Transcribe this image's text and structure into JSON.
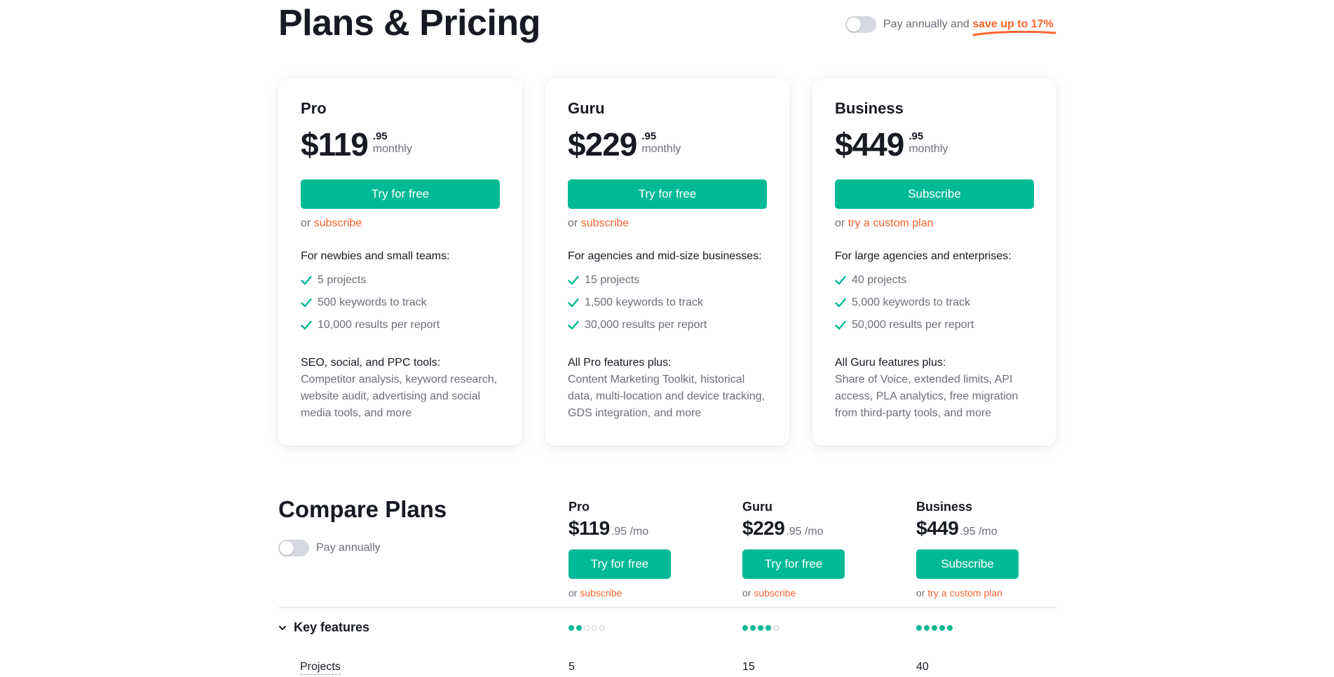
{
  "header": {
    "title": "Plans & Pricing",
    "billing_toggle": {
      "on": false,
      "label_prefix": "Pay annually and",
      "label_highlight": "save up to 17%"
    }
  },
  "plans": [
    {
      "name": "Pro",
      "price_main": "$119",
      "price_cents": ".95",
      "period": "monthly",
      "cta": "Try for free",
      "alt_prefix": "or",
      "alt_link": "subscribe",
      "audience": "For newbies and small teams:",
      "features": [
        "5 projects",
        "500 keywords to track",
        "10,000 results per report"
      ],
      "tools_heading": "SEO, social, and PPC tools:",
      "tools_desc": "Competitor analysis, keyword research, website audit, advertising and social media tools, and more"
    },
    {
      "name": "Guru",
      "price_main": "$229",
      "price_cents": ".95",
      "period": "monthly",
      "cta": "Try for free",
      "alt_prefix": "or",
      "alt_link": "subscribe",
      "audience": "For agencies and mid-size businesses:",
      "features": [
        "15 projects",
        "1,500 keywords to track",
        "30,000 results per report"
      ],
      "tools_heading": "All Pro features plus:",
      "tools_desc": "Content Marketing Toolkit, historical data, multi-location and device tracking, GDS integration, and more"
    },
    {
      "name": "Business",
      "price_main": "$449",
      "price_cents": ".95",
      "period": "monthly",
      "cta": "Subscribe",
      "alt_prefix": "or",
      "alt_link": "try a custom plan",
      "audience": "For large agencies and enterprises:",
      "features": [
        "40 projects",
        "5,000 keywords to track",
        "50,000 results per report"
      ],
      "tools_heading": "All Guru features plus:",
      "tools_desc": "Share of Voice, extended limits, API access, PLA analytics, free migration from third-party tools, and more"
    }
  ],
  "compare": {
    "title": "Compare Plans",
    "toggle_label": "Pay annually",
    "toggle_on": false,
    "columns": [
      {
        "name": "Pro",
        "price_main": "$119",
        "price_rest": ".95 /mo",
        "cta": "Try for free",
        "alt_prefix": "or",
        "alt_link": "subscribe",
        "key_features_rating": 2,
        "projects": "5"
      },
      {
        "name": "Guru",
        "price_main": "$229",
        "price_rest": ".95 /mo",
        "cta": "Try for free",
        "alt_prefix": "or",
        "alt_link": "subscribe",
        "key_features_rating": 4,
        "projects": "15"
      },
      {
        "name": "Business",
        "price_main": "$449",
        "price_rest": ".95 /mo",
        "cta": "Subscribe",
        "alt_prefix": "or",
        "alt_link": "try a custom plan",
        "key_features_rating": 5,
        "projects": "40"
      }
    ],
    "rating_max": 5,
    "key_features_label": "Key features",
    "projects_label": "Projects"
  },
  "colors": {
    "accent": "#00ba96",
    "link": "#ff642d",
    "text": "#171a22",
    "muted": "#6c6e79"
  }
}
